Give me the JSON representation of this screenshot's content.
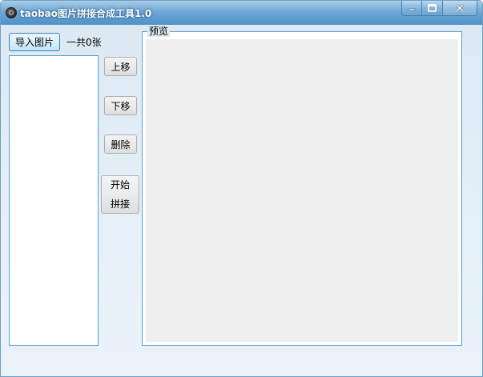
{
  "window": {
    "title": "taobao图片拼接合成工具1.0",
    "controls": {
      "minimize_icon": "minimize-icon",
      "maximize_icon": "maximize-icon",
      "close_icon": "close-icon"
    }
  },
  "toolbar": {
    "import_label": "导入图片",
    "count_text": "一共0张"
  },
  "file_list": {
    "items": []
  },
  "actions": {
    "move_up_label": "上移",
    "move_down_label": "下移",
    "delete_label": "删除",
    "start_line1": "开始",
    "start_line2": "拼接"
  },
  "preview": {
    "title": "预览"
  },
  "colors": {
    "titlebar": "#4f91c9",
    "panel_border": "#5ba0d6",
    "preview_background": "#efefef"
  }
}
